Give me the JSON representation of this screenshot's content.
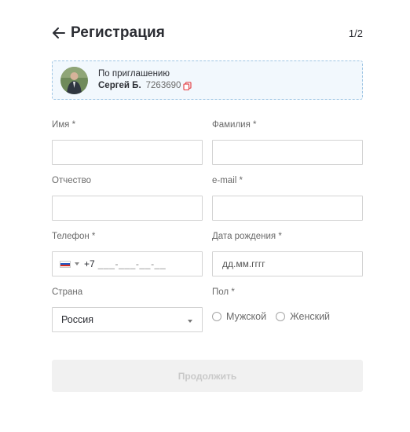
{
  "header": {
    "title": "Регистрация",
    "step": "1/2"
  },
  "invite": {
    "label": "По приглашению",
    "name": "Сергей Б.",
    "code": "7263690"
  },
  "form": {
    "first_name": {
      "label": "Имя *",
      "value": ""
    },
    "last_name": {
      "label": "Фамилия *",
      "value": ""
    },
    "middle_name": {
      "label": "Отчество",
      "value": ""
    },
    "email": {
      "label": "e-mail *",
      "value": ""
    },
    "phone": {
      "label": "Телефон *",
      "country_code": "+7",
      "mask": "___-___-__-__"
    },
    "birth_date": {
      "label": "Дата рождения *",
      "placeholder": "дд.мм.гггг"
    },
    "country": {
      "label": "Страна",
      "value": "Россия"
    },
    "gender": {
      "label": "Пол *",
      "options": [
        "Мужской",
        "Женский"
      ]
    }
  },
  "submit": {
    "label": "Продолжить"
  },
  "colors": {
    "accent_border": "#9fc6e4",
    "invite_background": "#f2f8fd",
    "copy_icon": "#e5484d",
    "disabled_button": "#f1f1f1",
    "disabled_text": "#c9c9c9"
  }
}
